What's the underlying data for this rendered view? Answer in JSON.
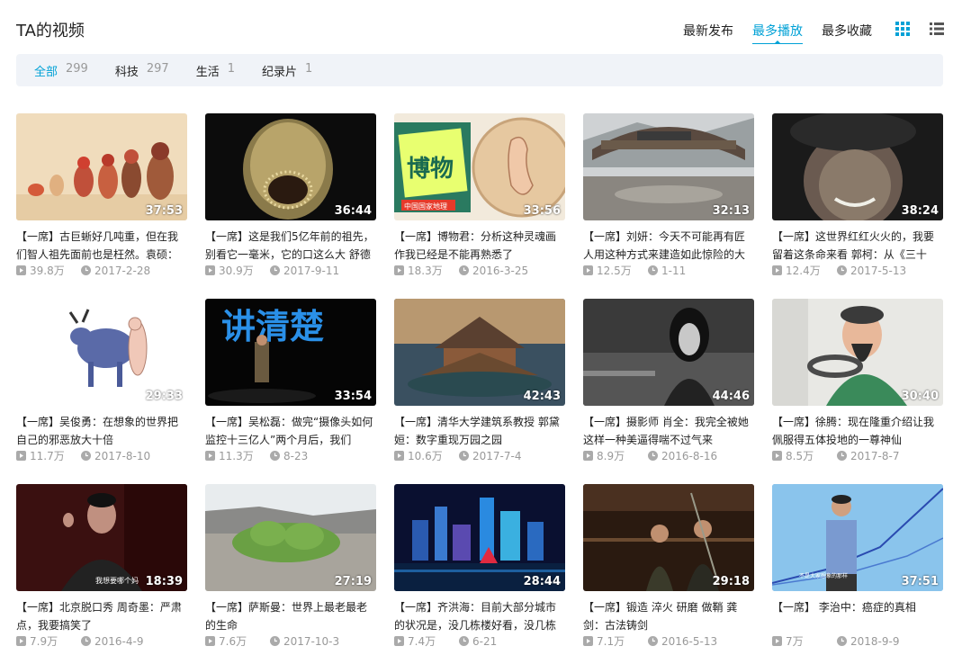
{
  "header": {
    "title": "TA的视频",
    "sort_tabs": [
      "最新发布",
      "最多播放",
      "最多收藏"
    ],
    "active_sort": 1
  },
  "filters": [
    {
      "label": "全部",
      "count": "299"
    },
    {
      "label": "科技",
      "count": "297"
    },
    {
      "label": "生活",
      "count": "1"
    },
    {
      "label": "纪录片",
      "count": "1"
    }
  ],
  "colors": {
    "accent": "#00a1d6",
    "filter_bg": "#f0f3f8",
    "meta": "#999999"
  },
  "videos": [
    {
      "title": "【一席】古巨蜥好几吨重，但在我们智人祖先面前也是枉然。袁硕：",
      "duration": "37:53",
      "plays": "39.8万",
      "date": "2017-2-28"
    },
    {
      "title": "【一席】这是我们5亿年前的祖先，别看它一毫米，它的口这么大 舒德",
      "duration": "36:44",
      "plays": "30.9万",
      "date": "2017-9-11"
    },
    {
      "title": "【一席】博物君：分析这种灵魂画作我已经是不能再熟悉了",
      "duration": "33:56",
      "plays": "18.3万",
      "date": "2016-3-25"
    },
    {
      "title": "【一席】刘妍：今天不可能再有匠人用这种方式来建造如此惊险的大",
      "duration": "32:13",
      "plays": "12.5万",
      "date": "1-11"
    },
    {
      "title": "【一席】这世界红红火火的，我要留着这条命来看 郭柯：从《三十",
      "duration": "38:24",
      "plays": "12.4万",
      "date": "2017-5-13"
    },
    {
      "title": "【一席】吴俊勇：在想象的世界把自己的邪恶放大十倍",
      "duration": "29:33",
      "plays": "11.7万",
      "date": "2017-8-10"
    },
    {
      "title": "【一席】吴松磊：做完“摄像头如何监控十三亿人”两个月后，我们",
      "duration": "33:54",
      "plays": "11.3万",
      "date": "8-23"
    },
    {
      "title": "【一席】清华大学建筑系教授 郭黛姮：数字重现万园之园",
      "duration": "42:43",
      "plays": "10.6万",
      "date": "2017-7-4"
    },
    {
      "title": "【一席】摄影师 肖全：我完全被她这样一种美逼得喘不过气来",
      "duration": "44:46",
      "plays": "8.9万",
      "date": "2016-8-16"
    },
    {
      "title": "【一席】徐腾：现在隆重介绍让我佩服得五体投地的一尊神仙",
      "duration": "30:40",
      "plays": "8.5万",
      "date": "2017-8-7"
    },
    {
      "title": "【一席】北京脱口秀 周奇墨：严肃点，我要搞笑了",
      "duration": "18:39",
      "plays": "7.9万",
      "date": "2016-4-9"
    },
    {
      "title": "【一席】萨斯曼：世界上最老最老的生命",
      "duration": "27:19",
      "plays": "7.6万",
      "date": "2017-10-3"
    },
    {
      "title": "【一席】齐洪海：目前大部分城市的状况是，没几栋楼好看，没几栋",
      "duration": "28:44",
      "plays": "7.4万",
      "date": "6-21"
    },
    {
      "title": "【一席】锻造 淬火 研磨 做鞘 龚剑：古法铸剑",
      "duration": "29:18",
      "plays": "7.1万",
      "date": "2016-5-13"
    },
    {
      "title": "【一席】 李治中：癌症的真相",
      "duration": "37:51",
      "plays": "7万",
      "date": "2018-9-9"
    }
  ],
  "thumb_texts": {
    "museum_word": "博物",
    "museum_sub": "中国国家地理",
    "speech_banner": "讲清楚",
    "caption_11": "我想要哪个妈",
    "caption_15": "不是大家想象的那样"
  }
}
